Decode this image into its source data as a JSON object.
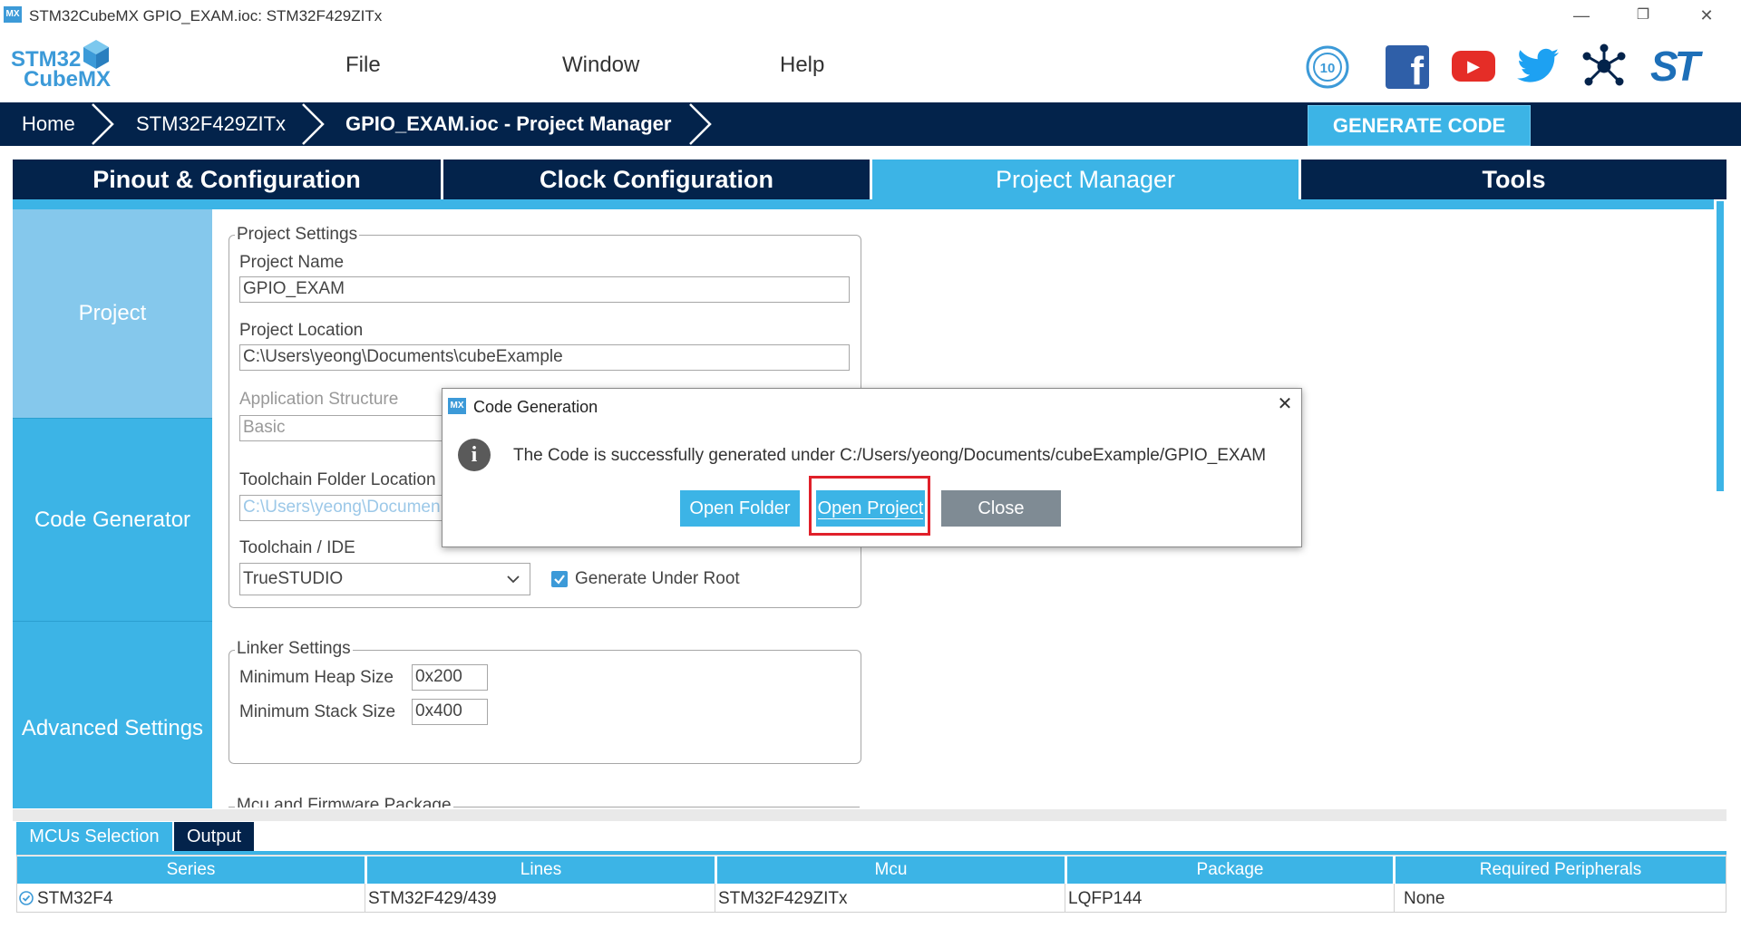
{
  "window": {
    "title": "STM32CubeMX GPIO_EXAM.ioc: STM32F429ZITx",
    "badge": "MX",
    "minimize": "—",
    "restore": "❐",
    "close": "✕"
  },
  "logo": {
    "line1": "STM32",
    "line2": "CubeMX"
  },
  "menu": {
    "file": "File",
    "window": "Window",
    "help": "Help"
  },
  "social": {
    "anniversary_icon": "anniversary-10-icon",
    "facebook": "f",
    "youtube": "▶",
    "twitter_icon": "twitter-icon",
    "network_icon": "network-icon",
    "st_logo": "ST"
  },
  "breadcrumb": {
    "home": "Home",
    "mcu": "STM32F429ZITx",
    "current": "GPIO_EXAM.ioc - Project Manager"
  },
  "generate_code": "GENERATE CODE",
  "tabs": {
    "pinout": "Pinout & Configuration",
    "clock": "Clock Configuration",
    "project_manager": "Project Manager",
    "tools": "Tools"
  },
  "nav": {
    "project": "Project",
    "code_generator": "Code Generator",
    "advanced": "Advanced Settings"
  },
  "project_settings": {
    "legend": "Project Settings",
    "name_label": "Project Name",
    "name_value": "GPIO_EXAM",
    "location_label": "Project Location",
    "location_value": "C:\\Users\\yeong\\Documents\\cubeExample",
    "structure_label": "Application Structure",
    "structure_value": "Basic",
    "toolchain_folder_label": "Toolchain Folder Location",
    "toolchain_folder_value": "C:\\Users\\yeong\\Documen",
    "ide_label": "Toolchain / IDE",
    "ide_value": "TrueSTUDIO",
    "generate_under_root": "Generate Under Root",
    "generate_under_root_checked": true
  },
  "linker_settings": {
    "legend": "Linker Settings",
    "heap_label": "Minimum Heap Size",
    "heap_value": "0x200",
    "stack_label": "Minimum Stack Size",
    "stack_value": "0x400"
  },
  "mcu_firmware": {
    "legend": "Mcu and Firmware Package"
  },
  "dialog": {
    "title": "Code Generation",
    "badge": "MX",
    "close": "✕",
    "info_icon": "i",
    "message": "The Code is successfully generated under C:/Users/yeong/Documents/cubeExample/GPIO_EXAM",
    "open_folder": "Open Folder",
    "open_project": "Open Project",
    "close_button": "Close",
    "highlight_color": "#e0202a"
  },
  "bottom": {
    "tabs": {
      "mcus_selection": "MCUs Selection",
      "output": "Output"
    },
    "columns": [
      "Series",
      "Lines",
      "Mcu",
      "Package",
      "Required Peripherals"
    ],
    "row": [
      "STM32F4",
      "STM32F429/439",
      "STM32F429ZITx",
      "LQFP144",
      "None"
    ]
  },
  "colors": {
    "navy": "#03234b",
    "accent": "#3cb4e6",
    "nav_light": "#85c8ec",
    "button_grey": "#7f8b94"
  }
}
